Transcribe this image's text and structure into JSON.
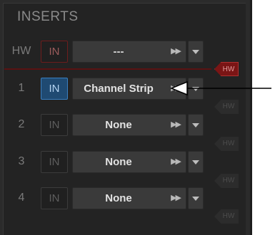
{
  "panel": {
    "title": "INSERTS"
  },
  "rows": [
    {
      "label": "HW",
      "in": "IN",
      "value": "---",
      "hw": "HW",
      "ff": "▶▶"
    },
    {
      "label": "1",
      "in": "IN",
      "value": "Channel Strip",
      "hw": "HW",
      "ff": "▶▶"
    },
    {
      "label": "2",
      "in": "IN",
      "value": "None",
      "hw": "HW",
      "ff": "▶▶"
    },
    {
      "label": "3",
      "in": "IN",
      "value": "None",
      "hw": "HW",
      "ff": "▶▶"
    },
    {
      "label": "4",
      "in": "IN",
      "value": "None",
      "hw": "HW",
      "ff": "▶▶"
    }
  ],
  "colors": {
    "panel_bg": "#232323",
    "in_active": "#1f4a72",
    "hw_active": "#7a1515"
  },
  "icons": {
    "select_arrow": "chevron-down-icon",
    "fast_forward": "fast-forward-icon"
  }
}
